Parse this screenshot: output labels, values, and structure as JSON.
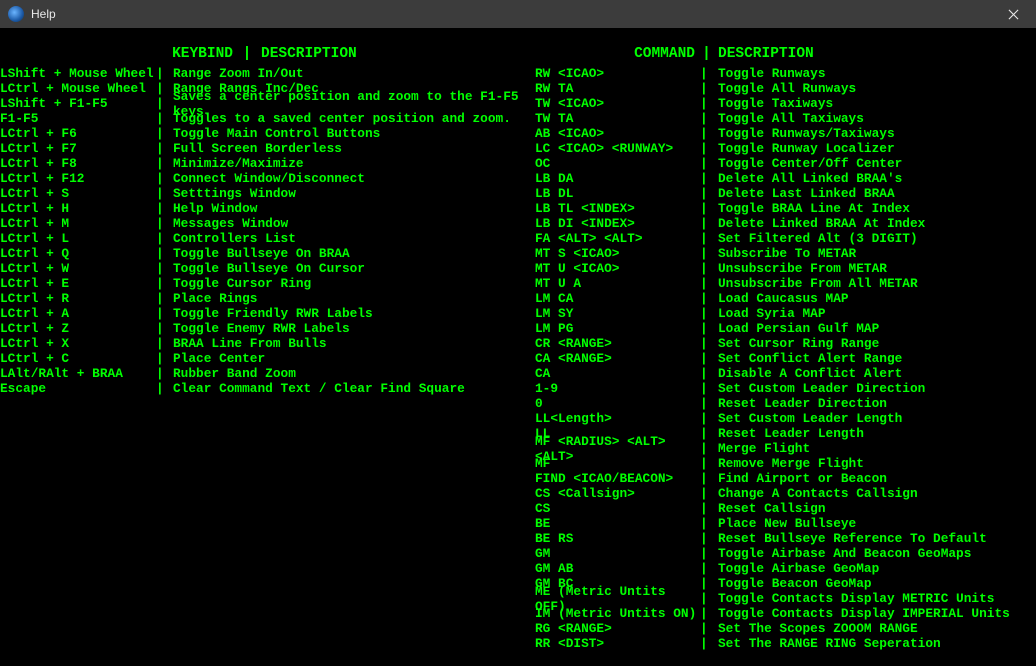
{
  "titlebar": {
    "title": "Help"
  },
  "separator": "|",
  "headers": {
    "left_key": "KEYBIND",
    "left_desc": "DESCRIPTION",
    "right_key": "COMMAND",
    "right_desc": "DESCRIPTION"
  },
  "keybinds": [
    {
      "k": "LShift + Mouse Wheel",
      "d": "Range Zoom In/Out"
    },
    {
      "k": "LCtrl + Mouse Wheel",
      "d": "Range Rangs Inc/Dec"
    },
    {
      "k": "LShift + F1-F5",
      "d": "Saves a center position and zoom to the F1-F5 keys."
    },
    {
      "k": "F1-F5",
      "d": "Toggles to a saved center position and zoom."
    },
    {
      "k": "LCtrl + F6",
      "d": "Toggle Main Control Buttons"
    },
    {
      "k": "LCtrl + F7",
      "d": "Full Screen Borderless"
    },
    {
      "k": "LCtrl + F8",
      "d": "Minimize/Maximize"
    },
    {
      "k": "LCtrl + F12",
      "d": "Connect Window/Disconnect"
    },
    {
      "k": "LCtrl + S",
      "d": "Setttings Window"
    },
    {
      "k": "LCtrl + H",
      "d": "Help Window"
    },
    {
      "k": "LCtrl + M",
      "d": "Messages Window"
    },
    {
      "k": "LCtrl + L",
      "d": "Controllers List"
    },
    {
      "k": "LCtrl + Q",
      "d": "Toggle Bullseye On BRAA"
    },
    {
      "k": "LCtrl + W",
      "d": "Toggle Bullseye On Cursor"
    },
    {
      "k": "LCtrl + E",
      "d": "Toggle Cursor Ring"
    },
    {
      "k": "LCtrl + R",
      "d": "Place Rings"
    },
    {
      "k": "LCtrl + A",
      "d": "Toggle Friendly RWR Labels"
    },
    {
      "k": "LCtrl + Z",
      "d": "Toggle Enemy RWR Labels"
    },
    {
      "k": "LCtrl + X",
      "d": "BRAA Line From Bulls"
    },
    {
      "k": "LCtrl + C",
      "d": "Place Center"
    },
    {
      "k": "LAlt/RAlt + BRAA",
      "d": "Rubber Band Zoom"
    },
    {
      "k": "Escape",
      "d": "Clear Command Text / Clear Find Square"
    }
  ],
  "commands": [
    {
      "k": "RW <ICAO>",
      "d": "Toggle Runways"
    },
    {
      "k": "RW TA",
      "d": "Toggle All Runways"
    },
    {
      "k": "TW <ICAO>",
      "d": "Toggle Taxiways"
    },
    {
      "k": "TW TA",
      "d": "Toggle All Taxiways"
    },
    {
      "k": "AB <ICAO>",
      "d": "Toggle Runways/Taxiways"
    },
    {
      "k": "LC <ICAO> <RUNWAY>",
      "d": "Toggle Runway Localizer"
    },
    {
      "k": "OC",
      "d": "Toggle Center/Off Center"
    },
    {
      "k": "LB DA",
      "d": "Delete All Linked BRAA's"
    },
    {
      "k": "LB DL",
      "d": "Delete Last Linked BRAA"
    },
    {
      "k": "LB TL <INDEX>",
      "d": "Toggle BRAA Line At Index"
    },
    {
      "k": "LB DI <INDEX>",
      "d": "Delete Linked BRAA At Index"
    },
    {
      "k": "FA <ALT> <ALT>",
      "d": "Set Filtered Alt (3 DIGIT)"
    },
    {
      "k": "MT S <ICAO>",
      "d": "Subscribe To METAR"
    },
    {
      "k": "MT U <ICAO>",
      "d": "Unsubscribe From METAR"
    },
    {
      "k": "MT U A",
      "d": "Unsubscribe From All METAR"
    },
    {
      "k": "LM CA",
      "d": "Load Caucasus MAP"
    },
    {
      "k": "LM SY",
      "d": "Load Syria MAP"
    },
    {
      "k": "LM PG",
      "d": "Load Persian Gulf MAP"
    },
    {
      "k": "CR <RANGE>",
      "d": "Set Cursor Ring Range"
    },
    {
      "k": "CA <RANGE>",
      "d": "Set Conflict Alert Range"
    },
    {
      "k": "CA",
      "d": "Disable A Conflict Alert"
    },
    {
      "k": "1-9",
      "d": "Set Custom Leader Direction"
    },
    {
      "k": "0",
      "d": "Reset Leader Direction"
    },
    {
      "k": "LL<Length>",
      "d": "Set Custom Leader Length"
    },
    {
      "k": "LL",
      "d": "Reset Leader Length"
    },
    {
      "k": "MF <RADIUS> <ALT> <ALT>",
      "d": "Merge Flight"
    },
    {
      "k": "MF",
      "d": "Remove Merge Flight"
    },
    {
      "k": "FIND <ICAO/BEACON>",
      "d": "Find Airport or Beacon"
    },
    {
      "k": "CS <Callsign>",
      "d": "Change A Contacts Callsign"
    },
    {
      "k": "CS",
      "d": "Reset Callsign"
    },
    {
      "k": "BE",
      "d": "Place New Bullseye"
    },
    {
      "k": "BE RS",
      "d": "Reset Bullseye Reference To Default"
    },
    {
      "k": "GM",
      "d": "Toggle Airbase And Beacon GeoMaps"
    },
    {
      "k": "GM AB",
      "d": "Toggle Airbase GeoMap"
    },
    {
      "k": "GM BC",
      "d": "Toggle Beacon GeoMap"
    },
    {
      "k": "ME (Metric Untits OFF)",
      "d": "Toggle Contacts Display METRIC Units"
    },
    {
      "k": "IM (Metric Untits ON)",
      "d": "Toggle Contacts Display IMPERIAL Units"
    },
    {
      "k": "RG <RANGE>",
      "d": "Set The Scopes ZOOOM RANGE"
    },
    {
      "k": "RR <DIST>",
      "d": "Set The RANGE RING Seperation"
    }
  ]
}
